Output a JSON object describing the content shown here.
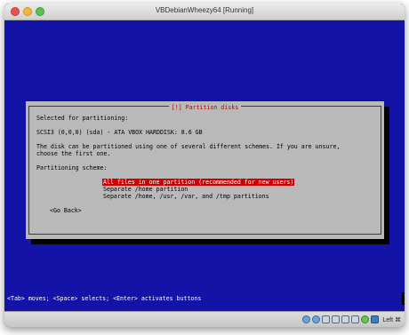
{
  "window": {
    "title": "VBDebianWheezy64 [Running]"
  },
  "dialog": {
    "title": "[!] Partition disks",
    "selected_label": "Selected for partitioning:",
    "disk_info": "SCSI3 (0,0,0) (sda) - ATA VBOX HARDDISK: 8.6 GB",
    "explanation_line1": "The disk can be partitioned using one of several different schemes. If you are unsure,",
    "explanation_line2": "choose the first one.",
    "scheme_label": "Partitioning scheme:",
    "options": [
      {
        "label": "All files in one partition (recommended for new users)",
        "selected": true
      },
      {
        "label": "Separate /home partition",
        "selected": false
      },
      {
        "label": "Separate /home, /usr, /var, and /tmp partitions",
        "selected": false
      }
    ],
    "go_back": "<Go Back>"
  },
  "statusline": "<Tab> moves; <Space> selects; <Enter> activates buttons",
  "vbox_statusbar": {
    "host_key": "Left ⌘",
    "icons": [
      "hard-disk-icon",
      "optical-drive-icon",
      "usb-icon",
      "shared-folder-icon",
      "network-icon",
      "display-icon",
      "video-capture-icon",
      "mouse-integration-icon"
    ]
  },
  "colors": {
    "screen_bg": "#1313a8",
    "dialog_bg": "#b9b9b9",
    "highlight": "#d00000",
    "title_red": "#c00000"
  }
}
